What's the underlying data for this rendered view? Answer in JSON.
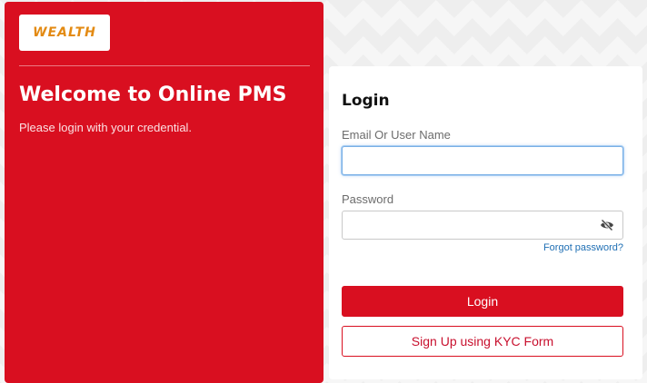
{
  "brand": {
    "logo_text": "WEALTH",
    "primary_color": "#d90f20",
    "logo_color": "#e38a12"
  },
  "welcome": {
    "title": "Welcome to Online PMS",
    "subtitle": "Please login with your credential."
  },
  "login": {
    "heading": "Login",
    "email_label": "Email Or User Name",
    "email_value": "",
    "password_label": "Password",
    "password_value": "",
    "password_toggle_icon": "eye-slash-icon",
    "forgot_password": "Forgot password?",
    "login_button": "Login",
    "signup_button": "Sign Up using KYC Form"
  }
}
